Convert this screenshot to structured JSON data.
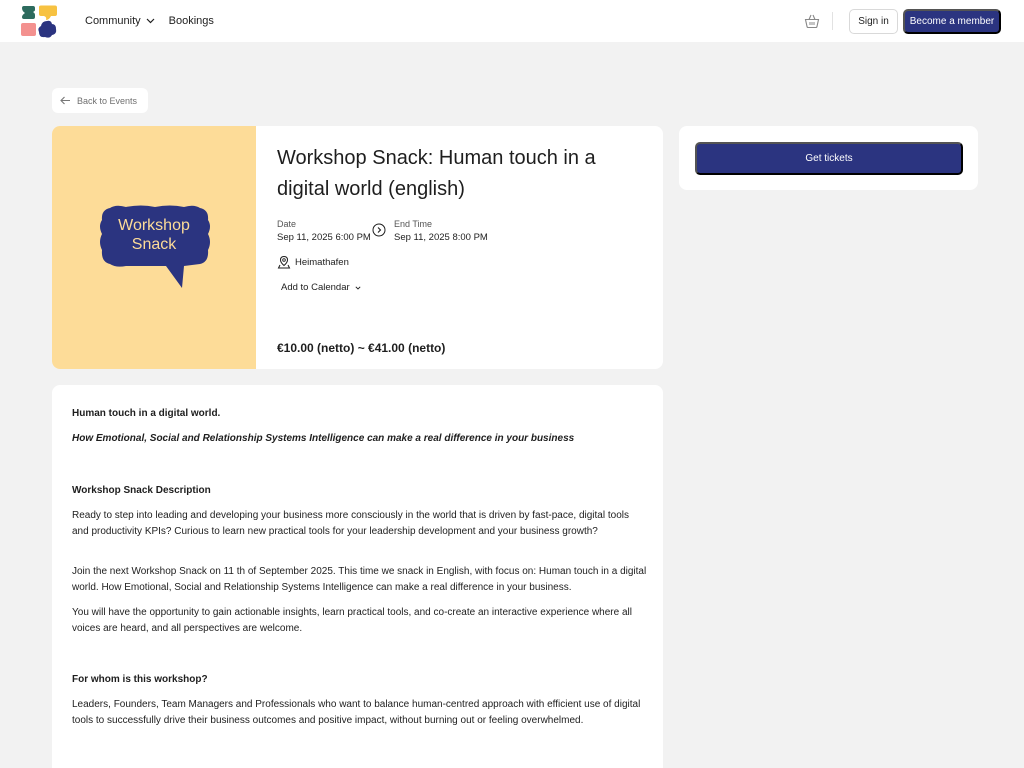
{
  "nav": {
    "community": "Community",
    "bookings": "Bookings",
    "sign_in": "Sign in",
    "become_member": "Become a member"
  },
  "icons": {
    "logo": "logo-icon",
    "community_chevron": "chevron-down-icon",
    "basket": "basket-icon",
    "back": "arrow-left-icon",
    "time_arrow": "arrow-right-circle-icon",
    "location": "map-pin-icon",
    "calendar_chevron": "chevron-down-icon"
  },
  "colors": {
    "primary": "#2b3480",
    "hero_bg": "#fddc98",
    "page_bg": "#f2f2f2"
  },
  "back_label": "Back to Events",
  "hero": {
    "image_text": "Workshop Snack",
    "title": "Workshop Snack: Human touch in a digital world (english)",
    "date_label": "Date",
    "date_value": "Sep 11, 2025 6:00 PM",
    "end_label": "End Time",
    "end_value": "Sep 11, 2025 8:00 PM",
    "location": "Heimathafen",
    "add_to_calendar": "Add to Calendar",
    "price": "€10.00 (netto) ~ €41.00 (netto)"
  },
  "tickets_label": "Get tickets",
  "description": {
    "heading": "Human touch in a digital world.",
    "subheading": "How Emotional, Social and Relationship Systems Intelligence can make a real difference in your business",
    "section1_title": "Workshop Snack Description",
    "para1": "Ready to step into leading and developing your business more consciously in the world that is driven by fast-pace, digital tools and productivity KPIs? Curious to learn new practical tools for your leadership development and your business growth?",
    "para2": "Join the next Workshop Snack on 11 th of September 2025. This time we snack in English, with focus on: Human touch in a digital world. How Emotional, Social and Relationship Systems Intelligence can make a real difference in your business.",
    "para3": "You will have the opportunity to gain actionable insights, learn practical tools, and co-create an interactive experience where all voices are heard, and all perspectives are welcome.",
    "section2_title": "For whom is this workshop?",
    "para4": "Leaders, Founders, Team Managers and Professionals who want to balance human-centred approach with efficient use of digital tools to successfully drive their business outcomes and positive impact, without burning out or feeling overwhelmed."
  }
}
